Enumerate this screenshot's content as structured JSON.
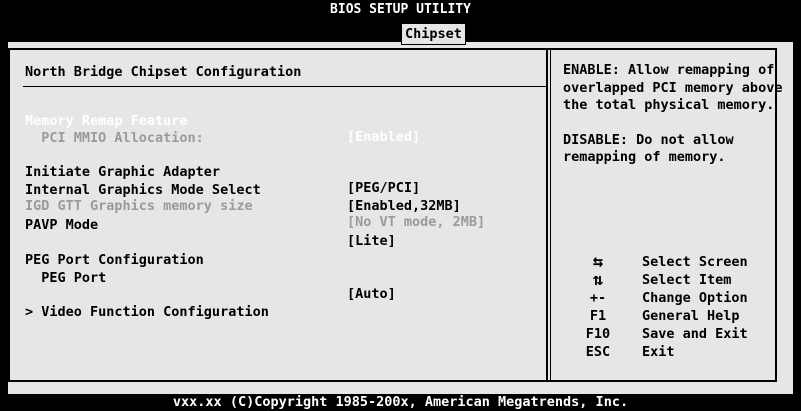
{
  "title": "BIOS SETUP UTILITY",
  "active_tab": "Chipset",
  "section_title": "North Bridge Chipset Configuration",
  "settings": [
    {
      "label": "Memory Remap Feature",
      "value": "[Enabled]"
    },
    {
      "label": "  PCI MMIO Allocation:",
      "value": ""
    },
    {
      "label": "Initiate Graphic Adapter",
      "value": "[PEG/PCI]"
    },
    {
      "label": "Internal Graphics Mode Select",
      "value": "[Enabled,32MB]"
    },
    {
      "label": "IGD GTT Graphics memory size",
      "value": "[No VT mode, 2MB]"
    },
    {
      "label": "PAVP Mode",
      "value": "[Lite]"
    },
    {
      "label": "PEG Port Configuration",
      "value": ""
    },
    {
      "label": "  PEG Port",
      "value": "[Auto]"
    },
    {
      "label": "> Video Function Configuration",
      "value": ""
    }
  ],
  "help": {
    "enable": "ENABLE: Allow remapping of overlapped PCI memory above the total physical memory.",
    "disable": "DISABLE: Do not allow remapping of memory."
  },
  "keys": [
    {
      "key": "⇆",
      "desc": "Select Screen"
    },
    {
      "key": "⇅",
      "desc": "Select Item"
    },
    {
      "key": "+-",
      "desc": "Change Option"
    },
    {
      "key": "F1",
      "desc": "General Help"
    },
    {
      "key": "F10",
      "desc": "Save and Exit"
    },
    {
      "key": "ESC",
      "desc": "Exit"
    }
  ],
  "footer": "vxx.xx (C)Copyright 1985-200x, American Megatrends, Inc."
}
